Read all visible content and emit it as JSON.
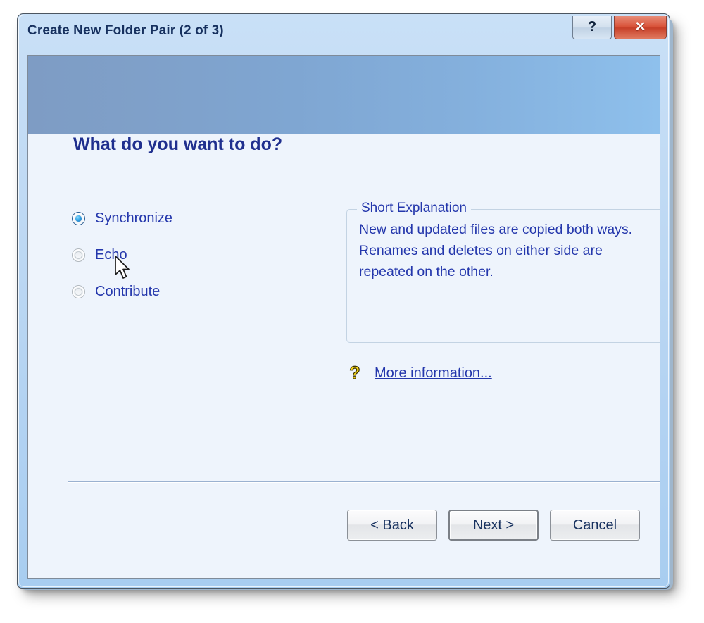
{
  "window": {
    "title": "Create New Folder Pair (2 of 3)",
    "help_button_glyph": "?",
    "close_button_glyph": "✕"
  },
  "content": {
    "heading": "What do you want to do?",
    "options": [
      {
        "label": "Synchronize",
        "selected": true
      },
      {
        "label": "Echo",
        "selected": false
      },
      {
        "label": "Contribute",
        "selected": false
      }
    ],
    "explanation": {
      "legend": "Short Explanation",
      "text": "New and updated files are copied both ways. Renames and deletes on either side are repeated on the other."
    },
    "more_information": {
      "icon_glyph": "?",
      "label": "More information..."
    }
  },
  "footer": {
    "back_label": "< Back",
    "next_label": "Next >",
    "cancel_label": "Cancel"
  },
  "colors": {
    "heading": "#1f2f8e",
    "link": "#2437ac",
    "banner_left": "#7e9cc4",
    "banner_right": "#8ec0ec",
    "client_background": "#eef4fc",
    "close_button": "#c73f28",
    "help_icon": "#f5d417"
  }
}
